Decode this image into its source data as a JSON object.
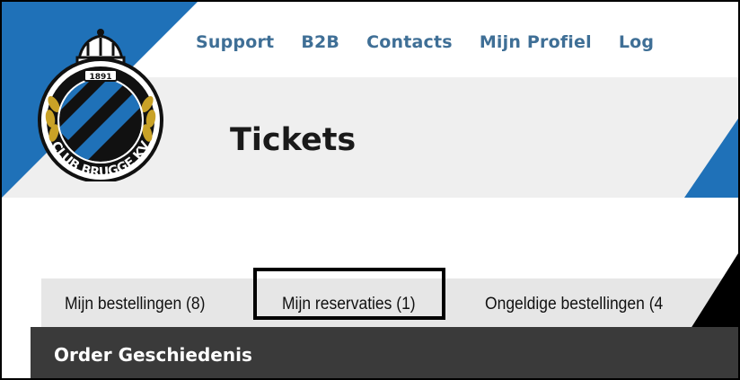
{
  "nav": {
    "items": [
      "Support",
      "B2B",
      "Contacts",
      "Mijn Profiel",
      "Log"
    ]
  },
  "page": {
    "title": "Tickets"
  },
  "logo": {
    "text": "CLUB BRUGGE KV",
    "year": "1891"
  },
  "tabs": [
    {
      "label": "Mijn bestellingen (8)"
    },
    {
      "label": "Mijn reservaties (1)"
    },
    {
      "label": "Ongeldige bestellingen (4"
    }
  ],
  "section": {
    "title": "Order Geschiedenis"
  },
  "colors": {
    "brand_blue": "#1f71b8",
    "nav_text": "#3f6f96",
    "header_dark": "#3a3a3a"
  }
}
